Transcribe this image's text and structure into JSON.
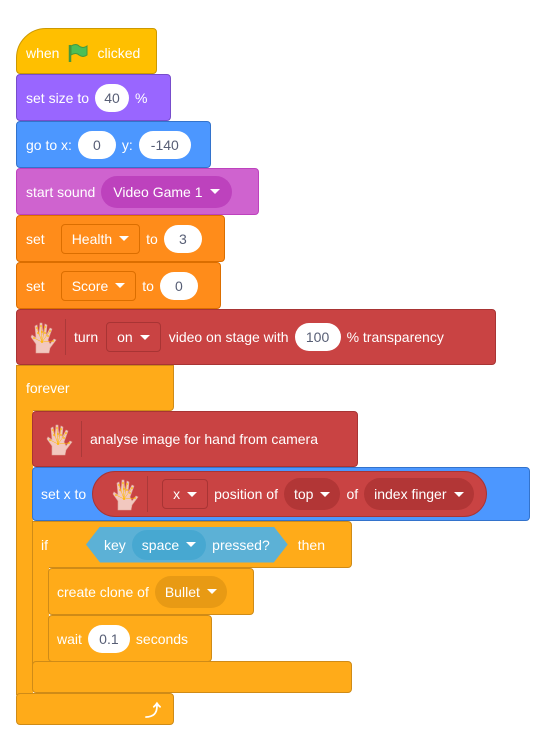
{
  "script": {
    "hat": {
      "when": "when",
      "flag_icon": "green-flag-icon",
      "clicked": "clicked"
    },
    "set_size": {
      "label": "set size to",
      "value": "40",
      "suffix": "%"
    },
    "go_to": {
      "label": "go to x:",
      "x": "0",
      "y_label": "y:",
      "y": "-140"
    },
    "start_sound": {
      "label": "start sound",
      "sound": "Video Game 1"
    },
    "set_health": {
      "label": "set",
      "variable": "Health",
      "to": "to",
      "value": "3"
    },
    "set_score": {
      "label": "set",
      "variable": "Score",
      "to": "to",
      "value": "0"
    },
    "video": {
      "icon": "hand-tracking-icon",
      "turn": "turn",
      "state": "on",
      "middle": "video on stage with",
      "value": "100",
      "suffix": "% transparency"
    },
    "forever": {
      "label": "forever",
      "loop_icon": "loop-arrow-icon"
    },
    "analyse": {
      "icon": "hand-tracking-icon",
      "label": "analyse image for hand from camera"
    },
    "set_x": {
      "label": "set x to",
      "reporter": {
        "icon": "hand-tracking-icon",
        "axis": "x",
        "position_of": "position of",
        "part": "top",
        "of": "of",
        "finger": "index finger"
      }
    },
    "if_block": {
      "if": "if",
      "key": "key",
      "key_value": "space",
      "pressed": "pressed?",
      "then": "then"
    },
    "create_clone": {
      "label": "create clone of",
      "target": "Bullet"
    },
    "wait": {
      "label": "wait",
      "value": "0.1",
      "suffix": "seconds"
    }
  }
}
